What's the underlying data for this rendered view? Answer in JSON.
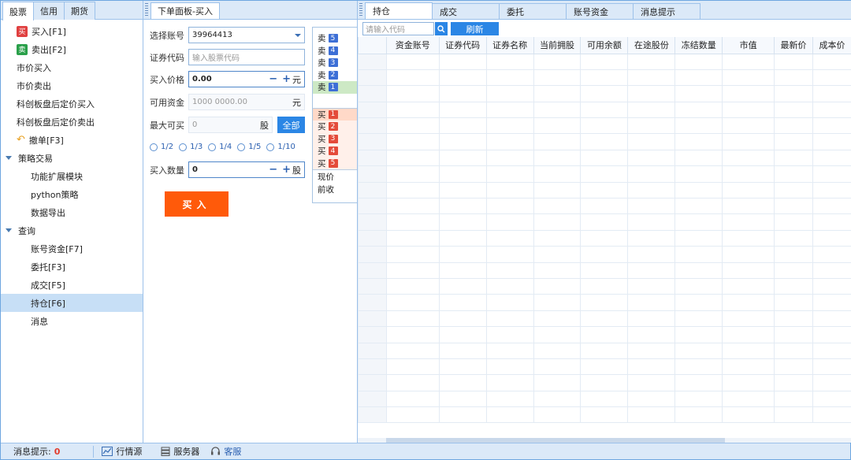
{
  "left": {
    "tabs": [
      "股票",
      "信用",
      "期货"
    ],
    "tree": [
      {
        "label": "买入[F1]",
        "badge": "买",
        "badge_color": "#e04040",
        "level": 1,
        "type": "item"
      },
      {
        "label": "卖出[F2]",
        "badge": "卖",
        "badge_color": "#2aa04a",
        "level": 1,
        "type": "item"
      },
      {
        "label": "市价买入",
        "level": 1,
        "type": "item"
      },
      {
        "label": "市价卖出",
        "level": 1,
        "type": "item"
      },
      {
        "label": "科创板盘后定价买入",
        "level": 1,
        "type": "item"
      },
      {
        "label": "科创板盘后定价卖出",
        "level": 1,
        "type": "item"
      },
      {
        "label": "撤单[F3]",
        "icon": "undo-icon",
        "level": 1,
        "type": "item"
      },
      {
        "label": "策略交易",
        "level": 0,
        "type": "group"
      },
      {
        "label": "功能扩展模块",
        "level": 2,
        "type": "item"
      },
      {
        "label": "python策略",
        "level": 2,
        "type": "item"
      },
      {
        "label": "数据导出",
        "level": 2,
        "type": "item"
      },
      {
        "label": "查询",
        "level": 0,
        "type": "group"
      },
      {
        "label": "账号资金[F7]",
        "level": 2,
        "type": "item"
      },
      {
        "label": "委托[F3]",
        "level": 2,
        "type": "item"
      },
      {
        "label": "成交[F5]",
        "level": 2,
        "type": "item"
      },
      {
        "label": "持仓[F6]",
        "level": 2,
        "type": "item",
        "selected": true
      },
      {
        "label": "消息",
        "level": 2,
        "type": "item"
      }
    ]
  },
  "order": {
    "tab": "下单面板-买入",
    "account_label": "选择账号",
    "account_value": "39964413",
    "code_label": "证券代码",
    "code_placeholder": "输入股票代码",
    "price_label": "买入价格",
    "price_value": "0.00",
    "price_unit": "元",
    "funds_label": "可用资金",
    "funds_value": "1000 0000.00",
    "funds_unit": "元",
    "max_label": "最大可买",
    "max_value": "0",
    "max_unit": "股",
    "all_label": "全部",
    "fractions": [
      "1/2",
      "1/3",
      "1/4",
      "1/5",
      "1/10"
    ],
    "qty_label": "买入数量",
    "qty_value": "0",
    "qty_unit": "股",
    "buy_button": "买入",
    "minus": "−",
    "plus": "+"
  },
  "book": {
    "sell": [
      {
        "label": "卖",
        "n": "5"
      },
      {
        "label": "卖",
        "n": "4"
      },
      {
        "label": "卖",
        "n": "3"
      },
      {
        "label": "卖",
        "n": "2"
      },
      {
        "label": "卖",
        "n": "1"
      }
    ],
    "buy": [
      {
        "label": "买",
        "n": "1"
      },
      {
        "label": "买",
        "n": "2"
      },
      {
        "label": "买",
        "n": "3"
      },
      {
        "label": "买",
        "n": "4"
      },
      {
        "label": "买",
        "n": "5"
      }
    ],
    "current_label": "现价",
    "prev_close_label": "前收"
  },
  "right": {
    "tabs": [
      "持仓",
      "成交",
      "委托",
      "账号资金",
      "消息提示"
    ],
    "search_placeholder": "请输入代码",
    "refresh_label": "刷新",
    "columns": [
      "资金账号",
      "证券代码",
      "证券名称",
      "当前拥股",
      "可用余额",
      "在途股份",
      "冻结数量",
      "市值",
      "最新价",
      "成本价"
    ]
  },
  "status": {
    "msg_label": "消息提示:",
    "msg_count": "0",
    "quote_label": "行情源",
    "server_label": "服务器",
    "service_label": "客服"
  }
}
